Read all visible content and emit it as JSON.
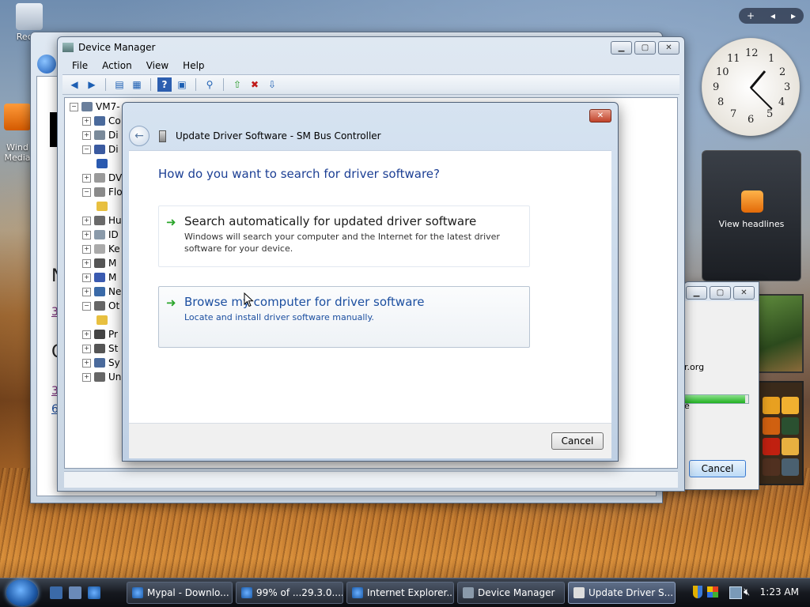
{
  "desktop": {
    "icons": [
      {
        "label": "Recyc"
      },
      {
        "label": "Wind\nMedia"
      }
    ]
  },
  "sidebar_controls": {
    "add": "+",
    "prev": "◂",
    "next": "▸"
  },
  "clock": {
    "numbers": [
      "12",
      "1",
      "2",
      "3",
      "4",
      "5",
      "6",
      "7",
      "8",
      "9",
      "10",
      "11"
    ]
  },
  "feed_gadget": {
    "label": "View headlines"
  },
  "ie_window": {
    "partial_texts": [
      "N",
      "3",
      "C",
      "3",
      "6"
    ]
  },
  "device_manager": {
    "title": "Device Manager",
    "menu": [
      "File",
      "Action",
      "View",
      "Help"
    ],
    "toolbar_icons": [
      "back-icon",
      "forward-icon",
      "properties-icon",
      "help-icon",
      "scan-icon",
      "update-icon",
      "uninstall-icon",
      "disable-icon"
    ],
    "tree": {
      "root": "VM7-",
      "items": [
        "Co",
        "Di",
        "Di",
        "",
        "DV",
        "Flo",
        "",
        "Hu",
        "ID",
        "Ke",
        "M",
        "M",
        "Ne",
        "Ot",
        "",
        "Pr",
        "St",
        "Sy",
        "Un"
      ]
    }
  },
  "dialog": {
    "title": "Update Driver Software - SM Bus Controller",
    "question": "How do you want to search for driver software?",
    "options": [
      {
        "title": "Search automatically for updated driver software",
        "desc": "Windows will search your computer and the Internet for the latest driver software for your device."
      },
      {
        "title": "Browse my computer for driver software",
        "desc": "Locate and install driver software manually."
      }
    ],
    "cancel_label": "Cancel"
  },
  "download_window": {
    "url_fragment": "r.org",
    "text_fragment": "e",
    "cancel_label": "Cancel",
    "progress": 0.95
  },
  "taskbar": {
    "tasks": [
      {
        "label": "Mypal - Downlo..."
      },
      {
        "label": "99% of ...29.3.0...."
      },
      {
        "label": "Internet Explorer..."
      },
      {
        "label": "Device Manager"
      },
      {
        "label": "Update Driver S..."
      }
    ],
    "time": "1:23 AM"
  },
  "colors": {
    "accent_blue": "#1c3f94",
    "link_blue": "#1c4fa0",
    "green_arrow": "#2aa52a"
  }
}
